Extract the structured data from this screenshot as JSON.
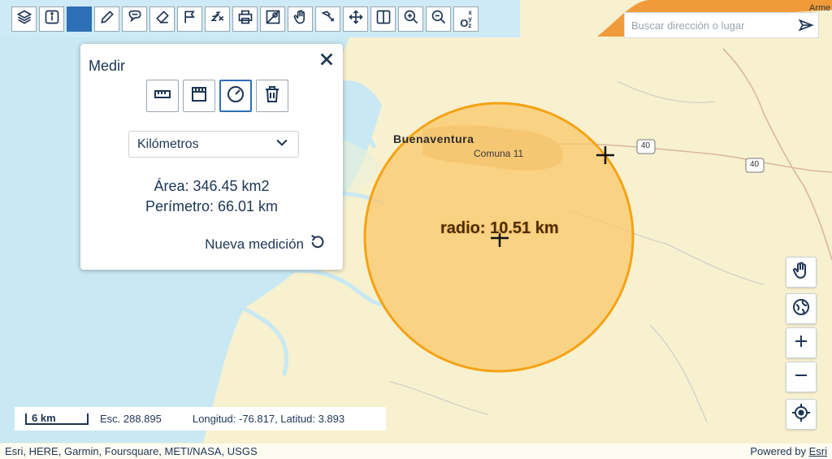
{
  "toolbar": {
    "items": [
      {
        "name": "layers-icon"
      },
      {
        "name": "info-icon"
      },
      {
        "name": "measure-tool-active"
      },
      {
        "name": "pencil-icon"
      },
      {
        "name": "speech-bubble-icon"
      },
      {
        "name": "eraser-icon"
      },
      {
        "name": "flag-icon"
      },
      {
        "name": "coordinates-icon"
      },
      {
        "name": "print-icon"
      },
      {
        "name": "map-pin-icon"
      },
      {
        "name": "hand-icon"
      },
      {
        "name": "tools-icon"
      },
      {
        "name": "pan-arrows-icon"
      },
      {
        "name": "split-view-icon"
      },
      {
        "name": "zoom-in-icon"
      },
      {
        "name": "zoom-out-icon"
      },
      {
        "name": "xyz-icon"
      }
    ],
    "xyz_label": "O"
  },
  "search": {
    "placeholder": "Buscar dirección o lugar"
  },
  "measure_panel": {
    "title": "Medir",
    "units": "Kilómetros",
    "area": "Área: 346.45 km2",
    "perimeter": "Perímetro: 66.01 km",
    "new_measurement": "Nueva medición"
  },
  "map": {
    "city_label": "Buenaventura",
    "district_label": "Comuna 11",
    "radius_label": "radio: 10.51 km",
    "road_shield_1": "40",
    "road_shield_2": "40",
    "corner_label": "Arme"
  },
  "scale": {
    "bar_label": "6 km",
    "scale_text": "Esc. 288.895",
    "coords": "Longitud: -76.817, Latitud: 3.893"
  },
  "attribution": {
    "sources": "Esri, HERE, Garmin, Foursquare, METI/NASA, USGS",
    "powered_prefix": "Powered by",
    "powered_link": "Esri"
  },
  "colors": {
    "water": "#c8e8f4",
    "land": "#f7f1cf",
    "measure_fill": "#fbc76a",
    "measure_stroke": "#f5a214",
    "accent": "#2d6fb6",
    "text": "#1e3554"
  }
}
